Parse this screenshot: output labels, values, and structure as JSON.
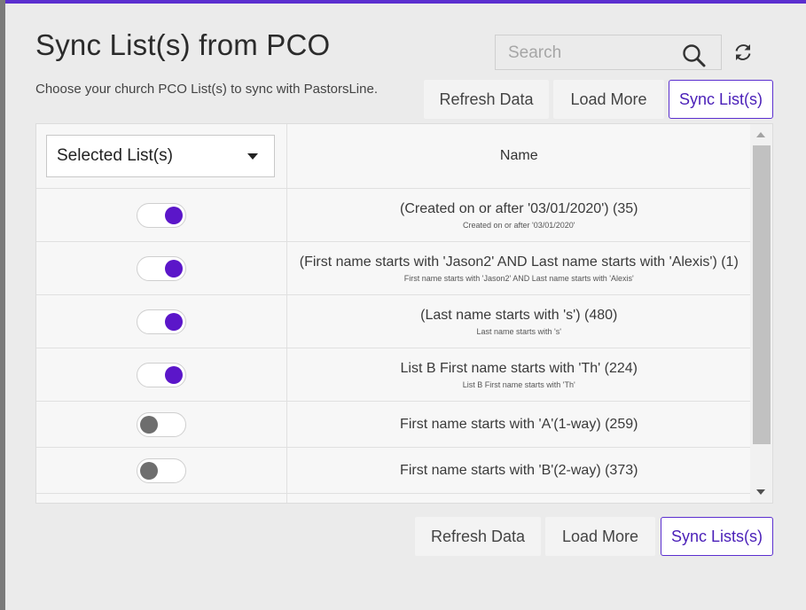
{
  "modal": {
    "title": "Sync List(s) from PCO",
    "subtitle": "Choose your church PCO List(s) to sync with PastorsLine.",
    "accent_color": "#5b2fcf"
  },
  "search": {
    "placeholder": "Search",
    "value": ""
  },
  "icons": {
    "search": "search-icon",
    "refresh": "refresh-icon",
    "dropdown": "chevron-down-icon"
  },
  "top_buttons": {
    "refresh": "Refresh Data",
    "load_more": "Load More",
    "sync": "Sync List(s)"
  },
  "bottom_buttons": {
    "refresh": "Refresh Data",
    "load_more": "Load More",
    "sync": "Sync Lists(s)"
  },
  "table": {
    "filter_selected": "Selected List(s)",
    "name_header": "Name",
    "rows": [
      {
        "name": "(Created on or after '03/01/2020') (35)",
        "sub": "Created on or after '03/01/2020'",
        "enabled": true
      },
      {
        "name": "(First name starts with 'Jason2' AND Last name starts with 'Alexis') (1)",
        "sub": "First name starts with 'Jason2' AND Last name starts with 'Alexis'",
        "enabled": true
      },
      {
        "name": "(Last name starts with 's') (480)",
        "sub": "Last name starts with 's'",
        "enabled": true
      },
      {
        "name": "List B First name starts with 'Th' (224)",
        "sub": "List B First name starts with 'Th'",
        "enabled": true
      },
      {
        "name": "First name starts with 'A'(1-way) (259)",
        "sub": "",
        "enabled": false
      },
      {
        "name": "First name starts with 'B'(2-way) (373)",
        "sub": "",
        "enabled": false
      }
    ]
  }
}
